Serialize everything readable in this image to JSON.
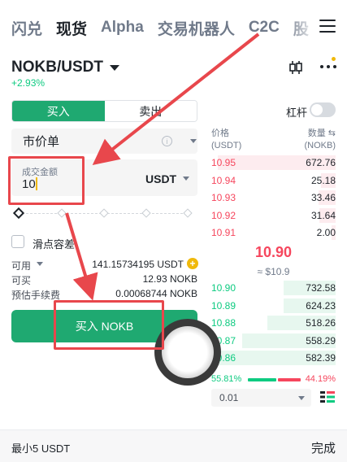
{
  "top_tabs": [
    "闪兑",
    "现货",
    "Alpha",
    "交易机器人",
    "C2C",
    "股"
  ],
  "pair": {
    "name": "NOKB/USDT",
    "change": "+2.93%"
  },
  "side": {
    "buy": "买入",
    "sell": "卖出"
  },
  "leverage_label": "杠杆",
  "order_type": "市价单",
  "amount": {
    "label": "成交金额",
    "value": "10",
    "unit": "USDT"
  },
  "slippage_label": "滑点容差",
  "info": {
    "available_label": "可用",
    "available_value": "141.15734195 USDT",
    "buyable_label": "可买",
    "buyable_value": "12.93 NOKB",
    "fee_label": "预估手续费",
    "fee_value": "0.00068744 NOKB"
  },
  "buy_button": "买入 NOKB",
  "orderbook": {
    "price_header": "价格",
    "price_unit": "(USDT)",
    "qty_header": "数量",
    "qty_unit": "(NOKB)",
    "asks": [
      {
        "price": "10.95",
        "qty": "672.76",
        "depth": 0.95
      },
      {
        "price": "10.94",
        "qty": "25.18",
        "depth": 0.12
      },
      {
        "price": "10.93",
        "qty": "33.46",
        "depth": 0.14
      },
      {
        "price": "10.92",
        "qty": "31.64",
        "depth": 0.13
      },
      {
        "price": "10.91",
        "qty": "2.00",
        "depth": 0.03
      }
    ],
    "mid_price": "10.90",
    "mid_usd": "≈ $10.9",
    "bids": [
      {
        "price": "10.90",
        "qty": "732.58",
        "depth": 0.42
      },
      {
        "price": "10.89",
        "qty": "624.23",
        "depth": 0.42
      },
      {
        "price": "10.88",
        "qty": "518.26",
        "depth": 0.55
      },
      {
        "price": "10.87",
        "qty": "558.29",
        "depth": 0.75
      },
      {
        "price": "10.86",
        "qty": "582.39",
        "depth": 1.0
      }
    ],
    "buy_ratio": "55.81%",
    "sell_ratio": "44.19%",
    "step": "0.01"
  },
  "bottom": {
    "min_note": "最小5 USDT",
    "done": "完成"
  },
  "colors": {
    "green": "#1fa971",
    "red": "#f6465d",
    "annotation": "#e8474c"
  }
}
